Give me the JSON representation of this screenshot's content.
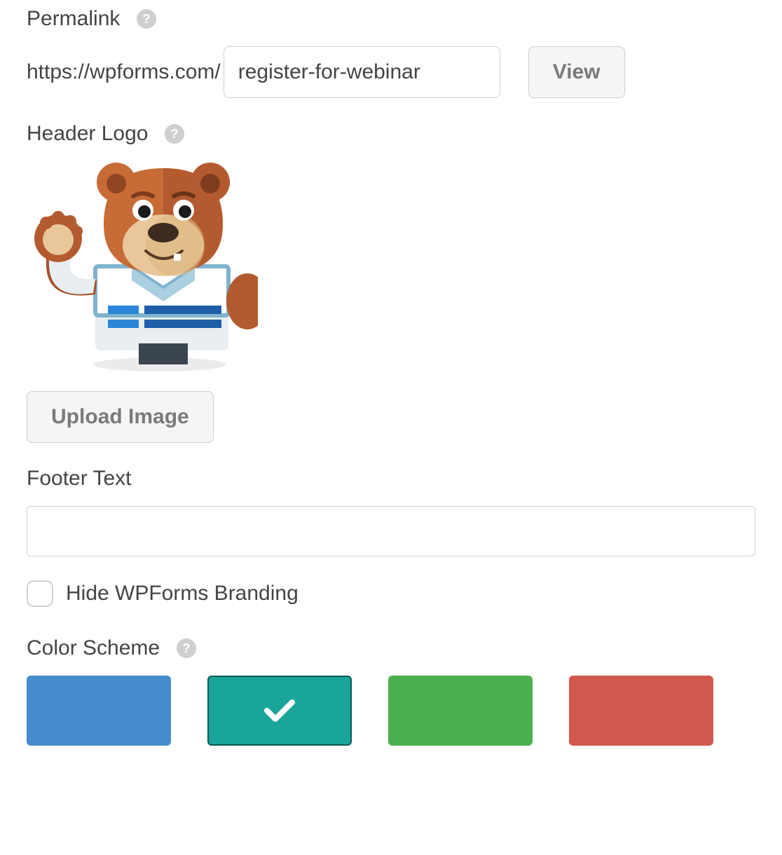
{
  "permalink": {
    "label": "Permalink",
    "prefix": "https://wpforms.com/",
    "slug": "register-for-webinar",
    "view_button": "View"
  },
  "header_logo": {
    "label": "Header Logo",
    "upload_button": "Upload Image"
  },
  "footer_text": {
    "label": "Footer Text",
    "value": ""
  },
  "hide_branding": {
    "label": "Hide WPForms Branding",
    "checked": false
  },
  "color_scheme": {
    "label": "Color Scheme",
    "options": [
      {
        "name": "blue",
        "hex": "#448ccb",
        "selected": false
      },
      {
        "name": "teal",
        "hex": "#1aa59a",
        "selected": true
      },
      {
        "name": "green",
        "hex": "#4caf50",
        "selected": false
      },
      {
        "name": "red",
        "hex": "#d1584f",
        "selected": false
      }
    ]
  }
}
